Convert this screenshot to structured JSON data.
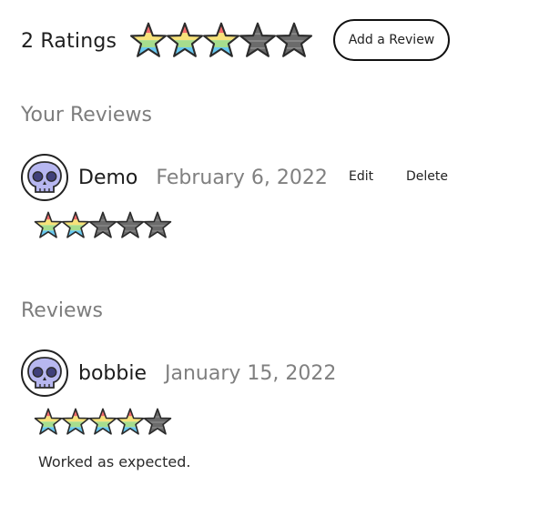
{
  "summary": {
    "ratings_label": "2 Ratings",
    "average_stars": 3,
    "max_stars": 5,
    "add_review_label": "Add a Review"
  },
  "your_reviews": {
    "title": "Your Reviews",
    "items": [
      {
        "username": "Demo",
        "date": "February 6, 2022",
        "stars": 2,
        "edit_label": "Edit",
        "delete_label": "Delete"
      }
    ]
  },
  "reviews": {
    "title": "Reviews",
    "items": [
      {
        "username": "bobbie",
        "date": "January 15, 2022",
        "stars": 4,
        "text": "Worked as expected."
      }
    ]
  },
  "colors": {
    "star_stripes": [
      "#f26b6b",
      "#f7e27a",
      "#a6dd8e",
      "#67c8f0"
    ],
    "star_empty": "#6b6b6b",
    "avatar_skull": "#b7b7f0"
  }
}
